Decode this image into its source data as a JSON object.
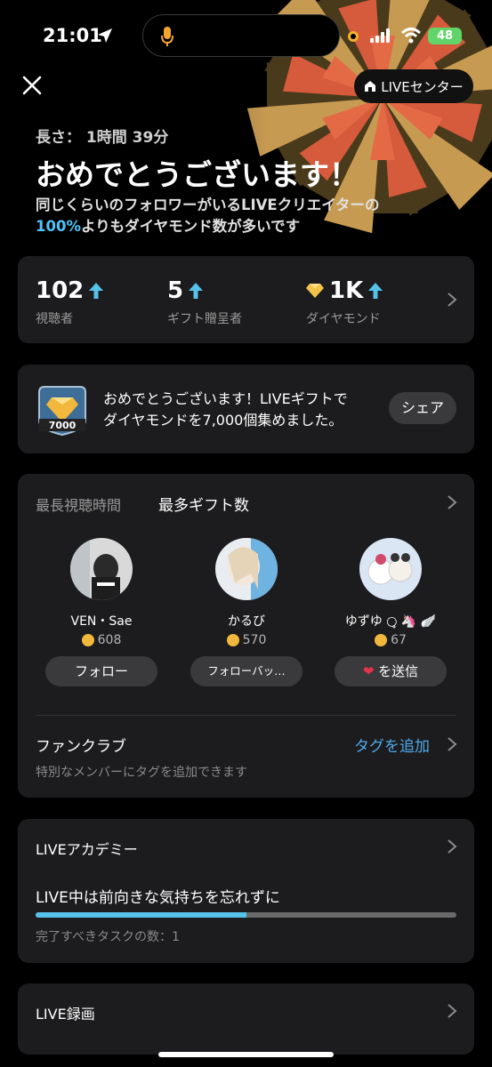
{
  "status_bar": {
    "time": "21:01",
    "battery": "48"
  },
  "header": {
    "live_center_label": "LIVEセンター"
  },
  "summary": {
    "duration": "長さ： 1時間 39分",
    "headline": "おめでとうございます！",
    "subline_a": "同じくらいのフォロワーがいるLIVEクリエイターの",
    "subline_percent": "100%",
    "subline_b": "よりもダイヤモンド数が多いです"
  },
  "stats": [
    {
      "value": "102",
      "label": "視聴者"
    },
    {
      "value": "5",
      "label": "ギフト贈呈者"
    },
    {
      "value": "1K",
      "label": "ダイヤモンド"
    }
  ],
  "badge_card": {
    "badge_number": "7000",
    "message_line1": "おめでとうございます！LIVEギフトで",
    "message_line2": "ダイヤモンドを7,000個集めました。",
    "share_label": "シェア"
  },
  "top_viewers": {
    "tab_longest": "最長視聴時間",
    "tab_gifts": "最多ギフト数",
    "people": [
      {
        "name": "VEN・Sae",
        "coins": "608",
        "button": "フォロー"
      },
      {
        "name": "かるび",
        "coins": "570",
        "button": "フォローバッ…"
      },
      {
        "name": "ゆずゆ",
        "coins": "67",
        "button": "を送信"
      }
    ]
  },
  "fan_club": {
    "title": "ファンクラブ",
    "subtitle": "特別なメンバーにタグを追加できます",
    "action": "タグを追加"
  },
  "academy": {
    "title": "LIVEアカデミー",
    "message": "LIVE中は前向きな気持ちを忘れずに",
    "progress": 0.5,
    "tasks_label": "完了すべきタスクの数：1"
  },
  "recording": {
    "title": "LIVE録画"
  },
  "colors": {
    "accent": "#4fc3f7",
    "link": "#4fa9e8",
    "progress": "#55c2ea",
    "card": "#1c1c1e"
  }
}
